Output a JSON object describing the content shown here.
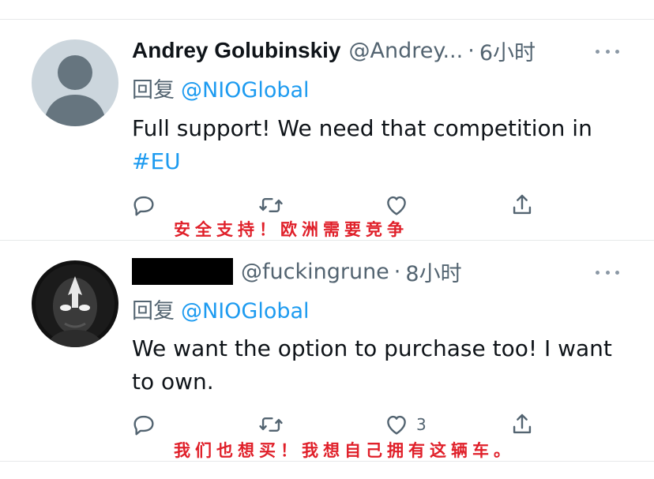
{
  "tweets": [
    {
      "display_name": "Andrey Golubinskiy",
      "handle": "@Andrey...",
      "separator": "·",
      "time": "6小时",
      "reply_prefix": "回复",
      "reply_to": "@NIOGlobal",
      "body_text": "Full support! We need that competition in",
      "body_hashtag": "#EU",
      "like_count": "",
      "overlay_caption": "安全支持！欧洲需要竞争"
    },
    {
      "display_name": "",
      "handle": "@fuckingrune",
      "separator": "·",
      "time": "8小时",
      "reply_prefix": "回复",
      "reply_to": "@NIOGlobal",
      "body_text": "We want the option to purchase too! I want to own.",
      "like_count": "3",
      "overlay_caption": "我们也想买！我想自己拥有这辆车。"
    }
  ],
  "icons": {
    "reply": "comment-icon",
    "retweet": "retweet-icon",
    "like": "heart-icon",
    "share": "share-icon",
    "more": "more-icon"
  },
  "colors": {
    "link": "#1d9bf0",
    "secondary": "#536471",
    "caption": "#e0202a"
  }
}
